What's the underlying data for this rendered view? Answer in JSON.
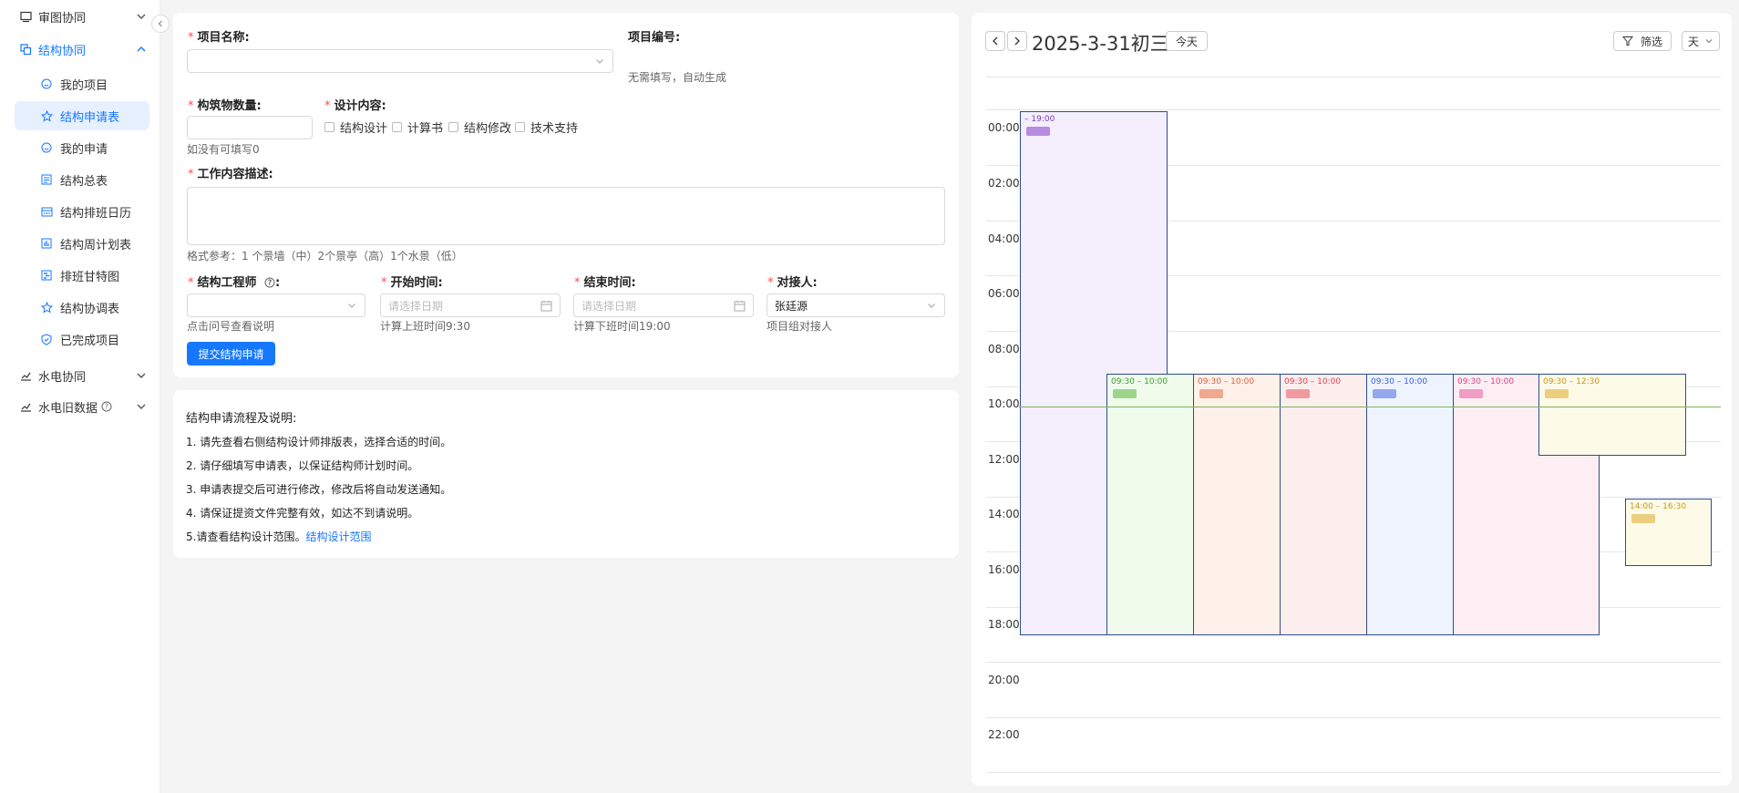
{
  "sidebar": {
    "groups": [
      {
        "label": "审图协同"
      },
      {
        "label": "结构协同"
      },
      {
        "label": "水电协同"
      },
      {
        "label": "水电旧数据"
      }
    ],
    "items": [
      {
        "label": "我的项目"
      },
      {
        "label": "结构申请表"
      },
      {
        "label": "我的申请"
      },
      {
        "label": "结构总表"
      },
      {
        "label": "结构排班日历"
      },
      {
        "label": "结构周计划表"
      },
      {
        "label": "排班甘特图"
      },
      {
        "label": "结构协调表"
      },
      {
        "label": "已完成项目"
      }
    ]
  },
  "form": {
    "project_name_label": "项目名称:",
    "project_no_label": "项目编号:",
    "project_no_hint": "无需填写，自动生成",
    "building_count_label": "构筑物数量:",
    "building_count_hint": "如没有可填写0",
    "design_content_label": "设计内容:",
    "design_options": [
      "结构设计",
      "计算书",
      "结构修改",
      "技术支持"
    ],
    "work_desc_label": "工作内容描述:",
    "work_desc_hint": "格式参考：1 个景墙（中）2个景亭（高）1个水景（低）",
    "engineer_label": "结构工程师",
    "engineer_hint": "点击问号查看说明",
    "start_label": "开始时间:",
    "start_placeholder": "请选择日期",
    "start_hint": "计算上班时间9:30",
    "end_label": "结束时间:",
    "end_placeholder": "请选择日期",
    "end_hint": "计算下班时间19:00",
    "contact_label": "对接人:",
    "contact_value": "张廷源",
    "contact_hint": "项目组对接人",
    "submit_label": "提交结构申请"
  },
  "info": {
    "title": "结构申请流程及说明:",
    "lines": [
      "1. 请先查看右侧结构设计师排版表，选择合适的时间。",
      "2. 请仔细填写申请表，以保证结构师计划时间。",
      "3. 申请表提交后可进行修改，修改后将自动发送通知。",
      "4. 请保证提资文件完整有效，如达不到请说明。",
      "5.请查看结构设计范围。"
    ],
    "link": "结构设计范围"
  },
  "calendar": {
    "prev": "<",
    "next": ">",
    "date": "2025-3-31初三",
    "today_label": "今天",
    "filter_label": "筛选",
    "view_label": "天",
    "hours": [
      "00:00",
      "02:00",
      "04:00",
      "06:00",
      "08:00",
      "10:00",
      "12:00",
      "14:00",
      "16:00",
      "18:00",
      "20:00",
      "22:00"
    ],
    "events": [
      {
        "time": "– 19:00",
        "color": "#7b3fbf",
        "bg": "#f5eefd",
        "blur": "#b58ce0"
      },
      {
        "time": "09:30 – 10:00",
        "color": "#3f9a2f",
        "bg": "#f0fbec",
        "blur": "#9ed48c"
      },
      {
        "time": "09:30 – 10:00",
        "color": "#d9603b",
        "bg": "#fdf1ea",
        "blur": "#f0a88e"
      },
      {
        "time": "09:30 – 10:00",
        "color": "#d9454e",
        "bg": "#fdeeee",
        "blur": "#ef9aa0"
      },
      {
        "time": "09:30 – 10:00",
        "color": "#3a5fcf",
        "bg": "#eef3fd",
        "blur": "#93a8ee"
      },
      {
        "time": "09:30 – 10:00",
        "color": "#d6408a",
        "bg": "#fdeef4",
        "blur": "#f09cc4"
      },
      {
        "time": "09:30 – 12:30",
        "color": "#c9971a",
        "bg": "#fdfae8",
        "blur": "#eccf7e"
      },
      {
        "time": "14:00 – 16:30",
        "color": "#c9971a",
        "bg": "#fdfae8",
        "blur": "#eccf7e"
      }
    ]
  }
}
